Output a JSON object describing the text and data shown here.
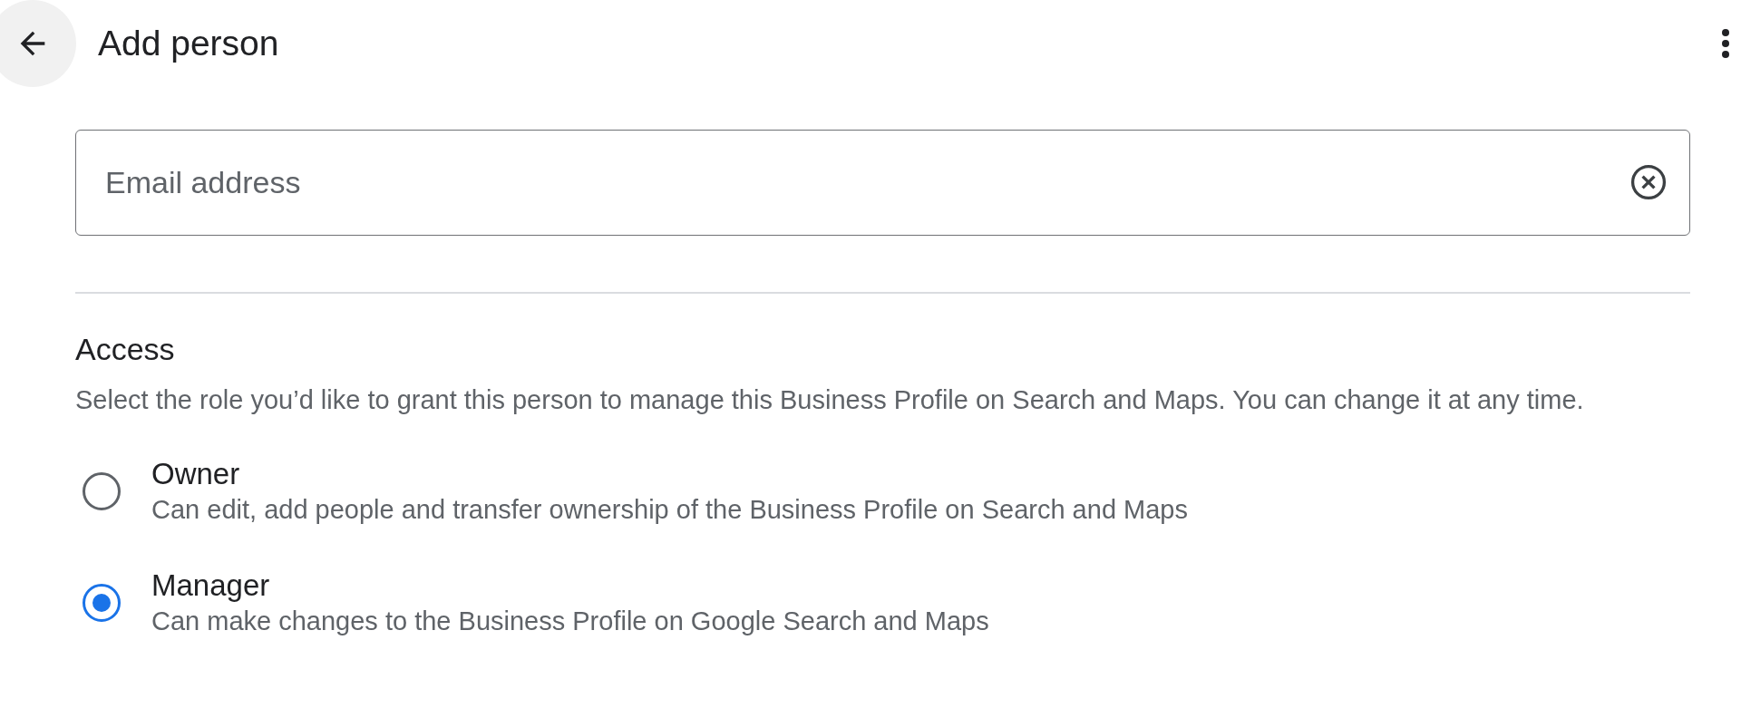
{
  "header": {
    "title": "Add person"
  },
  "email_field": {
    "placeholder": "Email address"
  },
  "access": {
    "heading": "Access",
    "description": "Select the role you’d like to grant this person to manage this Business Profile on Search and Maps. You can change it at any time.",
    "roles": [
      {
        "label": "Owner",
        "description": "Can edit, add people and transfer ownership of the Business Profile on Search and Maps",
        "selected": false
      },
      {
        "label": "Manager",
        "description": "Can make changes to the Business Profile on Google Search and Maps",
        "selected": true
      }
    ]
  }
}
